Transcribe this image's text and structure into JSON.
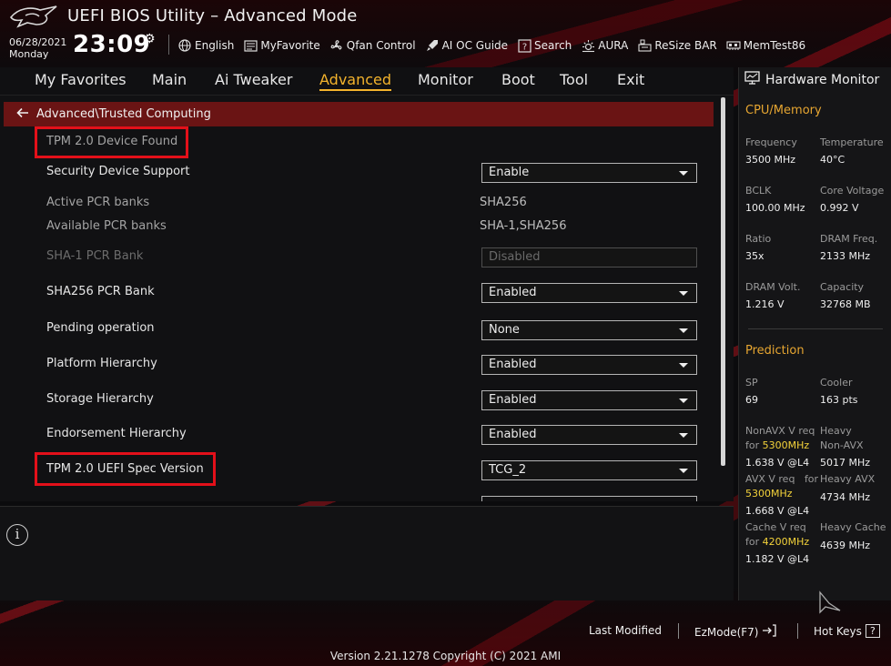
{
  "header": {
    "title": "UEFI BIOS Utility – Advanced Mode",
    "date": "06/28/2021",
    "day": "Monday",
    "time": "23:09",
    "toolbar": [
      {
        "label": "English",
        "icon": "globe-icon"
      },
      {
        "label": "MyFavorite",
        "icon": "favorite-icon"
      },
      {
        "label": "Qfan Control",
        "icon": "fan-icon"
      },
      {
        "label": "AI OC Guide",
        "icon": "rocket-icon"
      },
      {
        "label": "Search",
        "icon": "search-icon"
      },
      {
        "label": "AURA",
        "icon": "light-icon"
      },
      {
        "label": "ReSize BAR",
        "icon": "resize-bar-icon"
      },
      {
        "label": "MemTest86",
        "icon": "memory-icon"
      }
    ]
  },
  "nav": {
    "tabs": [
      "My Favorites",
      "Main",
      "Ai Tweaker",
      "Advanced",
      "Monitor",
      "Boot",
      "Tool",
      "Exit"
    ],
    "active": "Advanced"
  },
  "breadcrumb": "Advanced\\Trusted Computing",
  "settings": [
    {
      "label": "TPM 2.0 Device Found"
    },
    {
      "label": "Security Device Support",
      "value": "Enable"
    },
    {
      "label": "Active PCR banks",
      "value": "SHA256"
    },
    {
      "label": "Available PCR banks",
      "value": "SHA-1,SHA256"
    },
    {
      "label": "SHA-1 PCR Bank",
      "value": "Disabled"
    },
    {
      "label": "SHA256 PCR Bank",
      "value": "Enabled"
    },
    {
      "label": "Pending operation",
      "value": "None"
    },
    {
      "label": "Platform Hierarchy",
      "value": "Enabled"
    },
    {
      "label": "Storage Hierarchy",
      "value": "Enabled"
    },
    {
      "label": "Endorsement Hierarchy",
      "value": "Enabled"
    },
    {
      "label": "TPM 2.0 UEFI Spec Version",
      "value": "TCG_2"
    }
  ],
  "hardware_monitor": {
    "title": "Hardware Monitor",
    "cpu_memory": {
      "title": "CPU/Memory",
      "items": [
        {
          "label": "Frequency",
          "value": "3500 MHz"
        },
        {
          "label": "Temperature",
          "value": "40°C"
        },
        {
          "label": "BCLK",
          "value": "100.00 MHz"
        },
        {
          "label": "Core Voltage",
          "value": "0.992 V"
        },
        {
          "label": "Ratio",
          "value": "35x"
        },
        {
          "label": "DRAM Freq.",
          "value": "2133 MHz"
        },
        {
          "label": "DRAM Volt.",
          "value": "1.216 V"
        },
        {
          "label": "Capacity",
          "value": "32768 MB"
        }
      ]
    },
    "prediction": {
      "title": "Prediction",
      "sp_label": "SP",
      "sp_value": "69",
      "cooler_label": "Cooler",
      "cooler_value": "163 pts",
      "nonavx_label_1": "NonAVX V req",
      "nonavx_label_2": "for",
      "nonavx_freq": "5300MHz",
      "nonavx_value": "1.638 V @L4",
      "heavy_nonavx_label_1": "Heavy",
      "heavy_nonavx_label_2": "Non-AVX",
      "heavy_nonavx_value": "5017 MHz",
      "avx_label_1": "AVX V req",
      "avx_label_2": "for",
      "avx_freq": "5300MHz",
      "avx_value": "1.668 V @L4",
      "heavy_avx_label": "Heavy AVX",
      "heavy_avx_value": "4734 MHz",
      "cache_label_1": "Cache V req",
      "cache_label_2": "for",
      "cache_freq": "4200MHz",
      "cache_value": "1.182 V @L4",
      "heavy_cache_label": "Heavy Cache",
      "heavy_cache_value": "4639 MHz"
    }
  },
  "footer": {
    "last_modified": "Last Modified",
    "ezmode": "EzMode(F7)",
    "hotkeys": "Hot Keys",
    "hotkeys_key": "?",
    "version": "Version 2.21.1278 Copyright (C) 2021 AMI"
  },
  "colors": {
    "accent": "#f3b32c",
    "breadcrumb_bg": "#6a1414",
    "highlight_box": "#e3101a",
    "prediction_freq": "#f3d23a"
  }
}
